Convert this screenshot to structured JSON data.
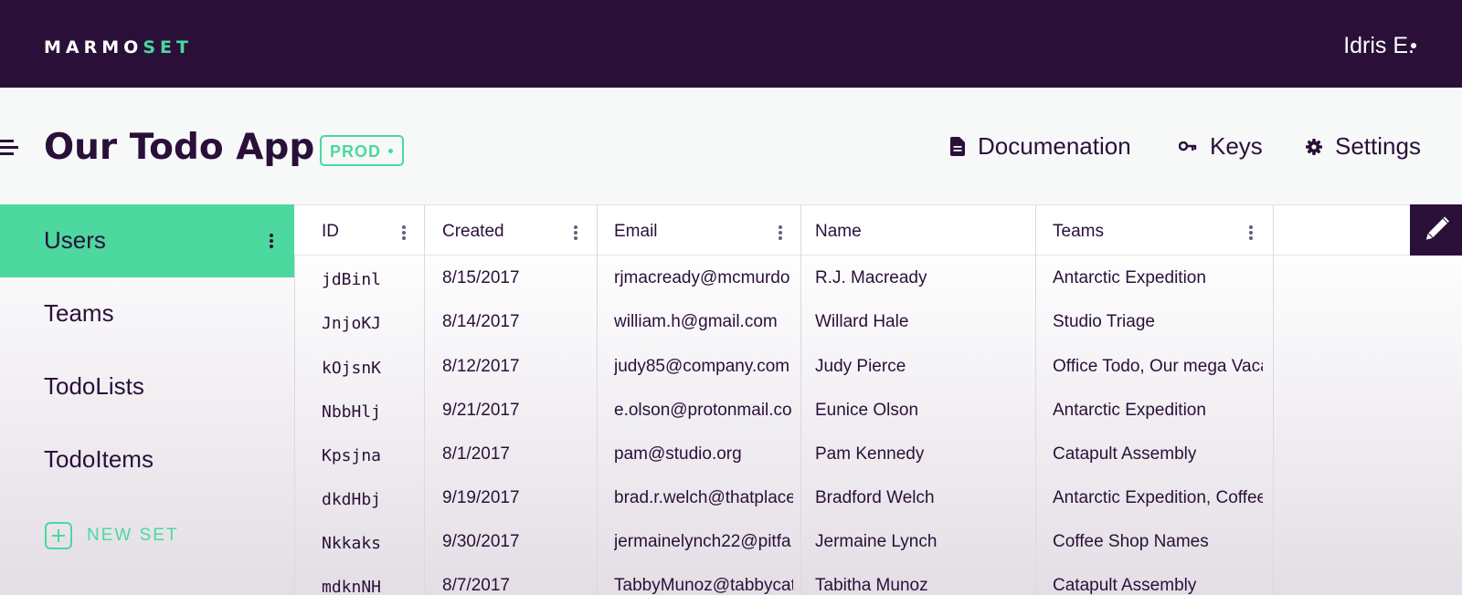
{
  "brand": {
    "logo_main": "MARMO",
    "logo_accent": "SET"
  },
  "user": {
    "name": "Idris E."
  },
  "app": {
    "title": "Our Todo App",
    "env_badge": "PROD"
  },
  "nav": {
    "documentation": "Documenation",
    "keys": "Keys",
    "settings": "Settings"
  },
  "sidebar": {
    "items": [
      {
        "label": "Users",
        "active": true
      },
      {
        "label": "Teams"
      },
      {
        "label": "TodoLists"
      },
      {
        "label": "TodoItems"
      }
    ],
    "new_set": "NEW SET"
  },
  "table": {
    "columns": [
      "ID",
      "Created",
      "Email",
      "Name",
      "Teams"
    ],
    "rows": [
      [
        "jdBinl",
        "8/15/2017",
        "rjmacready@mcmurdo",
        "R.J. Macready",
        "Antarctic Expedition"
      ],
      [
        "JnjoKJ",
        "8/14/2017",
        "william.h@gmail.com",
        "Willard Hale",
        "Studio Triage"
      ],
      [
        "kOjsnK",
        "8/12/2017",
        "judy85@company.com",
        "Judy Pierce",
        "Office Todo, Our mega Vaca"
      ],
      [
        "NbbHlj",
        "9/21/2017",
        "e.olson@protonmail.co",
        "Eunice Olson",
        "Antarctic Expedition"
      ],
      [
        "Kpsjna",
        "8/1/2017",
        "pam@studio.org",
        "Pam Kennedy",
        "Catapult Assembly"
      ],
      [
        "dkdHbj",
        "9/19/2017",
        "brad.r.welch@thatplace",
        "Bradford Welch",
        "Antarctic Expedition, Coffee"
      ],
      [
        "Nkkaks",
        "9/30/2017",
        "jermainelynch22@pitfa",
        "Jermaine Lynch",
        "Coffee Shop Names"
      ],
      [
        "mdknNH",
        "8/7/2017",
        "TabbyMunoz@tabbycat",
        "Tabitha Munoz",
        "Catapult Assembly"
      ]
    ]
  },
  "colors": {
    "dark": "#2a1039",
    "accent": "#4cd89e"
  }
}
